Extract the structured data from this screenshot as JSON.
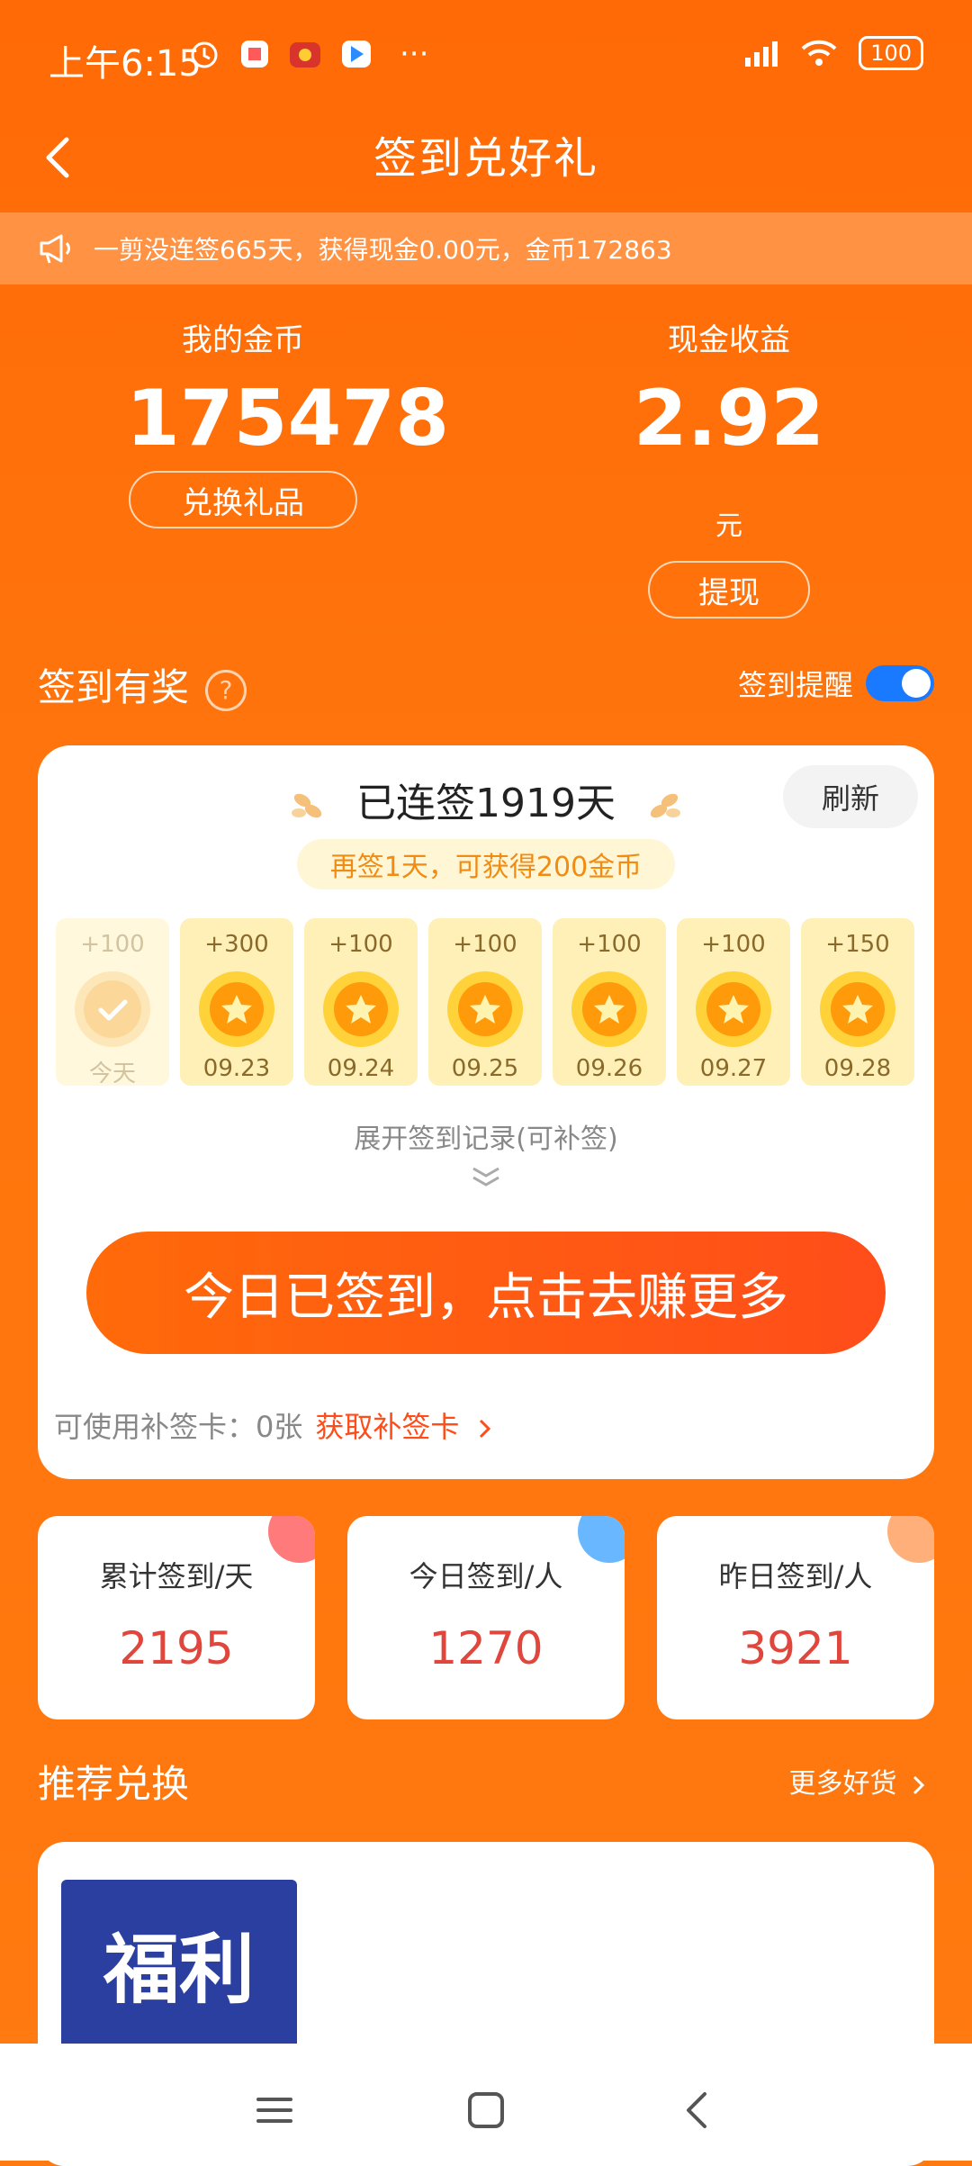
{
  "status": {
    "time": "上午6:15",
    "battery": "100",
    "more_dots": "···"
  },
  "nav": {
    "title": "签到兑好礼"
  },
  "notice": {
    "text": "一剪没连签665天，获得现金0.00元，金币172863"
  },
  "stats": {
    "coins_label": "我的金币",
    "coins_value": "175478",
    "coins_button": "兑换礼品",
    "cash_label": "现金收益",
    "cash_value": "2.92",
    "cash_unit": "元",
    "cash_button": "提现"
  },
  "checkin": {
    "title": "签到有奖",
    "help": "?",
    "remind_label": "签到提醒",
    "remind_on": true,
    "streak": "已连签1919天",
    "refresh": "刷新",
    "bonus": "再签1天，可获得200金币",
    "days": [
      {
        "reward": "+100",
        "date": "今天",
        "today": true
      },
      {
        "reward": "+300",
        "date": "09.23"
      },
      {
        "reward": "+100",
        "date": "09.24"
      },
      {
        "reward": "+100",
        "date": "09.25"
      },
      {
        "reward": "+100",
        "date": "09.26"
      },
      {
        "reward": "+100",
        "date": "09.27"
      },
      {
        "reward": "+150",
        "date": "09.28"
      }
    ],
    "expand": "展开签到记录(可补签)",
    "main_button": "今日已签到，点击去赚更多",
    "makeup_label": "可使用补签卡：0张",
    "makeup_link": "获取补签卡"
  },
  "summary": [
    {
      "label": "累计签到/天",
      "value": "2195",
      "color": "#ff7b7b"
    },
    {
      "label": "今日签到/人",
      "value": "1270",
      "color": "#69b7ff"
    },
    {
      "label": "昨日签到/人",
      "value": "3921",
      "color": "#ffb07a"
    }
  ],
  "recommend": {
    "title": "推荐兑换",
    "more": "更多好货",
    "item_label": "福利"
  },
  "colors": {
    "accent": "#ff7a10",
    "button": "#ff4d1a",
    "toggle": "#1a7aff"
  }
}
